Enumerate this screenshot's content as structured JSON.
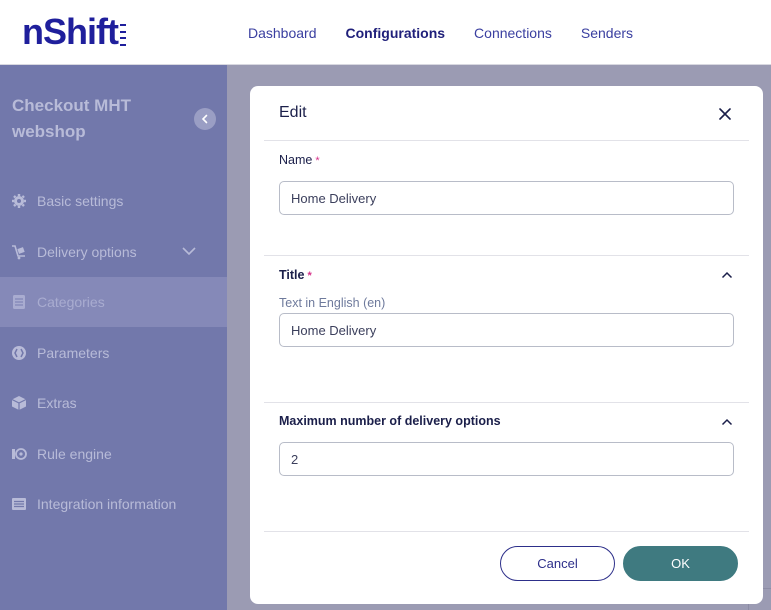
{
  "brand": {
    "logo_text": "nShift"
  },
  "nav": {
    "items": [
      {
        "label": "Dashboard",
        "active": false
      },
      {
        "label": "Configurations",
        "active": true
      },
      {
        "label": "Connections",
        "active": false
      },
      {
        "label": "Senders",
        "active": false
      }
    ]
  },
  "sidebar": {
    "title": "Checkout MHT webshop",
    "items": [
      {
        "label": "Basic settings",
        "icon": "gear-icon"
      },
      {
        "label": "Delivery options",
        "icon": "delivery-cart-icon"
      },
      {
        "label": "Categories",
        "icon": "categories-icon",
        "active": true
      },
      {
        "label": "Parameters",
        "icon": "parameters-icon"
      },
      {
        "label": "Extras",
        "icon": "box-icon"
      },
      {
        "label": "Rule engine",
        "icon": "rule-engine-icon"
      },
      {
        "label": "Integration information",
        "icon": "list-icon"
      }
    ]
  },
  "modal": {
    "title": "Edit",
    "name_label": "Name",
    "name_value": "Home Delivery",
    "title_section_label": "Title",
    "title_sub_label": "Text in English (en)",
    "title_value": "Home Delivery",
    "max_options_label": "Maximum number of delivery options",
    "max_options_value": "2",
    "required_marker": "*",
    "cancel_label": "Cancel",
    "ok_label": "OK"
  },
  "colors": {
    "brand": "#1f1f9c",
    "sidebar_bg": "#7278ab",
    "ok_button": "#3f7a80",
    "required": "#d6338a"
  }
}
